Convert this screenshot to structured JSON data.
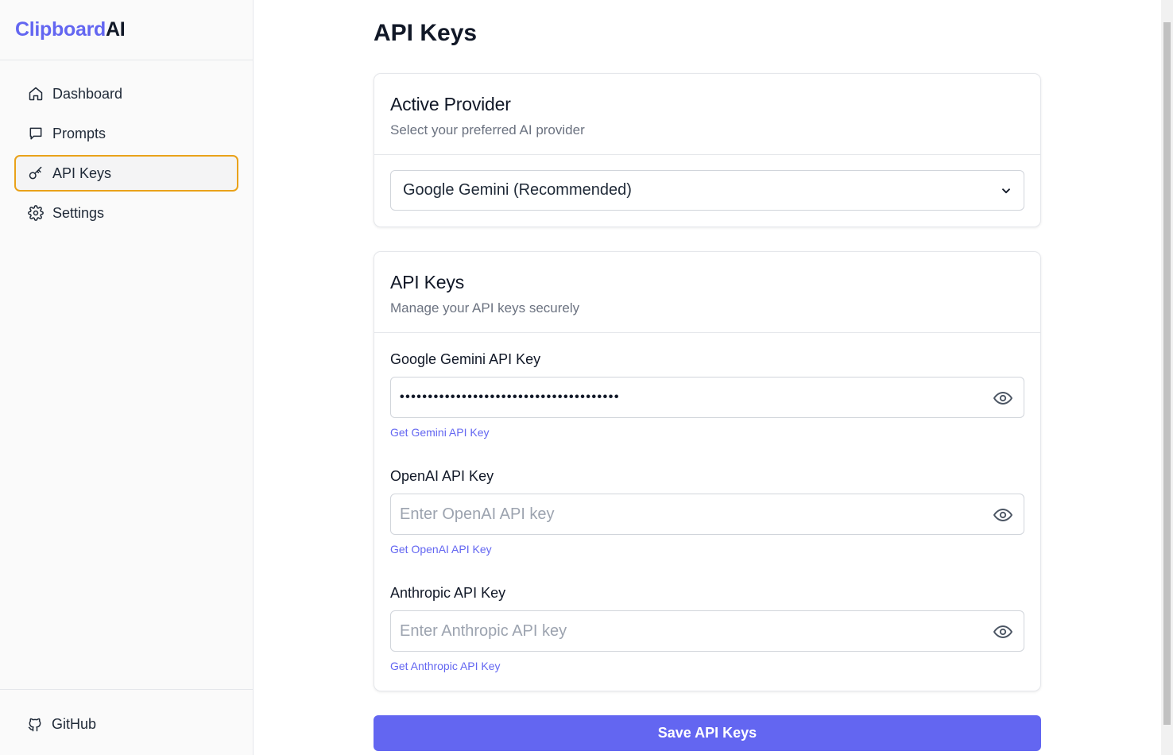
{
  "brand": {
    "part1": "Clipboard",
    "part2": "AI"
  },
  "sidebar": {
    "items": [
      {
        "label": "Dashboard",
        "icon": "home-icon",
        "active": false
      },
      {
        "label": "Prompts",
        "icon": "message-icon",
        "active": false
      },
      {
        "label": "API Keys",
        "icon": "key-icon",
        "active": true
      },
      {
        "label": "Settings",
        "icon": "gear-icon",
        "active": false
      }
    ],
    "footer": {
      "label": "GitHub",
      "icon": "github-icon"
    }
  },
  "page": {
    "title": "API Keys"
  },
  "provider_card": {
    "title": "Active Provider",
    "subtitle": "Select your preferred AI provider",
    "selected": "Google Gemini (Recommended)"
  },
  "keys_card": {
    "title": "API Keys",
    "subtitle": "Manage your API keys securely",
    "fields": [
      {
        "label": "Google Gemini API Key",
        "value": "•••••••••••••••••••••••••••••••••••••••",
        "placeholder": "",
        "link": "Get Gemini API Key"
      },
      {
        "label": "OpenAI API Key",
        "value": "",
        "placeholder": "Enter OpenAI API key",
        "link": "Get OpenAI API Key"
      },
      {
        "label": "Anthropic API Key",
        "value": "",
        "placeholder": "Enter Anthropic API key",
        "link": "Get Anthropic API Key"
      }
    ]
  },
  "actions": {
    "save_label": "Save API Keys"
  },
  "colors": {
    "accent": "#6366f1",
    "active_border": "#e9a21a"
  }
}
